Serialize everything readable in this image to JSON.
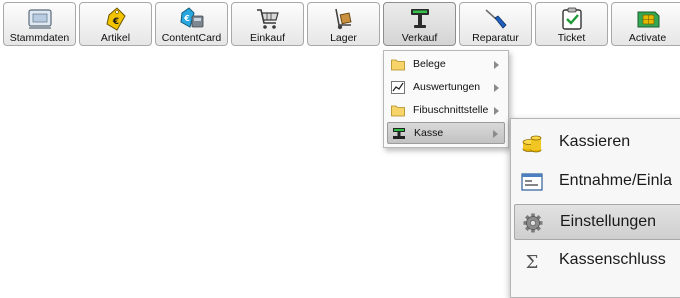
{
  "toolbar": {
    "buttons": [
      {
        "label": "Stammdaten",
        "icon": "master-data-icon"
      },
      {
        "label": "Artikel",
        "icon": "euro-tag-icon"
      },
      {
        "label": "ContentCard",
        "icon": "content-card-icon"
      },
      {
        "label": "Einkauf",
        "icon": "shopping-cart-icon"
      },
      {
        "label": "Lager",
        "icon": "hand-truck-icon"
      },
      {
        "label": "Verkauf",
        "icon": "pos-terminal-icon"
      },
      {
        "label": "Reparatur",
        "icon": "screwdriver-icon"
      },
      {
        "label": "Ticket",
        "icon": "checkbox-clipboard-icon"
      },
      {
        "label": "Activate",
        "icon": "sim-card-icon"
      }
    ],
    "active": "Verkauf"
  },
  "menu": {
    "items": [
      {
        "label": "Belege",
        "icon": "folder-icon"
      },
      {
        "label": "Auswertungen",
        "icon": "chart-icon"
      },
      {
        "label": "Fibuschnittstelle",
        "icon": "folder-icon"
      },
      {
        "label": "Kasse",
        "icon": "cash-register-icon"
      }
    ],
    "selected": "Kasse"
  },
  "submenu": {
    "items": [
      {
        "label": "Kassieren",
        "icon": "coins-icon"
      },
      {
        "label": "Entnahme/Einla",
        "icon": "form-icon"
      },
      {
        "label": "Einstellungen",
        "icon": "gear-icon"
      },
      {
        "label": "Kassenschluss",
        "icon": "sigma-icon"
      }
    ],
    "hovered": "Einstellungen"
  },
  "colors": {
    "accent_yellow": "#e8b400",
    "button_border": "#a9a9a9",
    "gear_gray": "#7a7a7a"
  }
}
